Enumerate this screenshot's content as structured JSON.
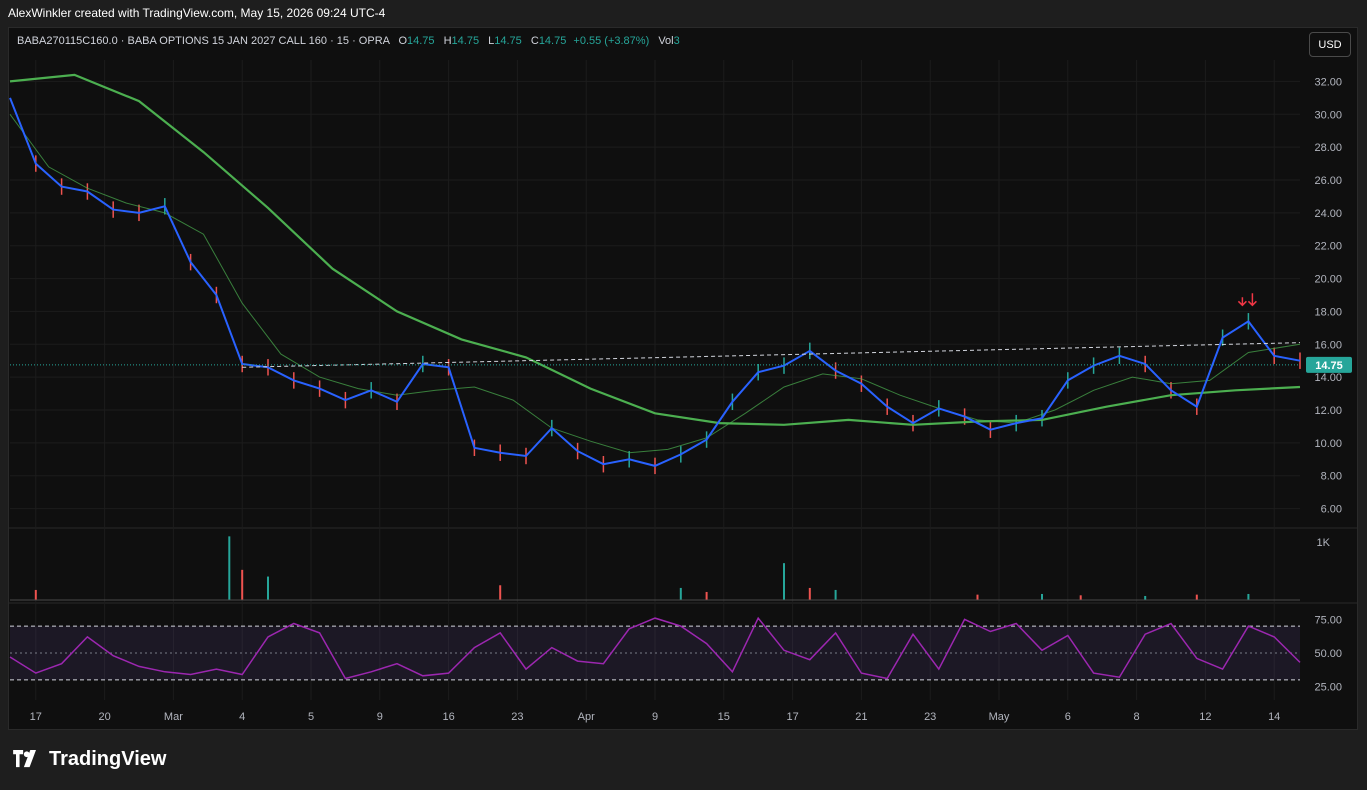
{
  "header": {
    "attribution": "AlexWinkler created with TradingView.com, May 15, 2026 09:24 UTC-4"
  },
  "legend": {
    "symbol": "BABA270115C160.0 · BABA OPTIONS 15 JAN 2027 CALL 160 · 15 · OPRA",
    "o_label": "O",
    "o_value": "14.75",
    "h_label": "H",
    "h_value": "14.75",
    "l_label": "L",
    "l_value": "14.75",
    "c_label": "C",
    "c_value": "14.75",
    "change": "+0.55 (+3.87%)",
    "vol_label": "Vol",
    "vol_value": "3"
  },
  "currency_button": "USD",
  "brand": {
    "name": "TradingView",
    "icon": "tradingview-logo"
  },
  "colors": {
    "price_line": "#2962ff",
    "ema_fast": "#4caf50",
    "ema_slow": "#4caf50",
    "candle_up": "#26a69a",
    "candle_down": "#ef5350",
    "rsi": "#9c27b0",
    "last_price_badge": "#26a69a",
    "signal_arrow": "#f23645"
  },
  "chart_data": [
    {
      "type": "line",
      "title": "",
      "ylim": [
        5,
        33
      ],
      "y_ticks": [
        "32.00",
        "30.00",
        "28.00",
        "26.00",
        "24.00",
        "22.00",
        "20.00",
        "18.00",
        "16.00",
        "14.00",
        "12.00",
        "10.00",
        "8.00",
        "6.00"
      ],
      "x_ticks": [
        "17",
        "20",
        "Mar",
        "4",
        "5",
        "9",
        "16",
        "23",
        "Apr",
        "9",
        "15",
        "17",
        "21",
        "23",
        "May",
        "6",
        "8",
        "12",
        "14"
      ],
      "last_price": "14.75",
      "series": [
        {
          "x": [
            0,
            2,
            4,
            6,
            8,
            10,
            12,
            14,
            16,
            18,
            20,
            22,
            24,
            26,
            28,
            30,
            32,
            34,
            36,
            38,
            40,
            42,
            44,
            46,
            48,
            50,
            52,
            54,
            56,
            58,
            60,
            62,
            64,
            66,
            68,
            70,
            72,
            74,
            76,
            78,
            80,
            82,
            84,
            86,
            88,
            90,
            92,
            94,
            96,
            98,
            100
          ],
          "values": [
            31,
            27,
            25.6,
            25.3,
            24.2,
            24,
            24.4,
            21,
            19,
            14.8,
            14.6,
            13.8,
            13.3,
            12.6,
            13.2,
            12.5,
            14.8,
            14.6,
            9.7,
            9.4,
            9.2,
            10.9,
            9.5,
            8.7,
            9.0,
            8.6,
            9.3,
            10.2,
            12.5,
            14.3,
            14.7,
            15.6,
            14.4,
            13.6,
            12.2,
            11.2,
            12.1,
            11.6,
            10.8,
            11.2,
            11.5,
            13.8,
            14.7,
            15.3,
            14.8,
            13.2,
            12.2,
            16.4,
            17.4,
            15.3,
            15.0
          ]
        },
        {
          "x": [
            0,
            3,
            6,
            9,
            12,
            15,
            18,
            21,
            24,
            27,
            30,
            33,
            36,
            39,
            42,
            45,
            48,
            51,
            54,
            57,
            60,
            63,
            66,
            69,
            72,
            75,
            78,
            81,
            84,
            87,
            90,
            93,
            96,
            100
          ],
          "values": [
            30,
            26.8,
            25.5,
            24.6,
            24,
            22.7,
            18.5,
            15.4,
            14,
            13.3,
            12.9,
            13.2,
            13.4,
            12.6,
            10.9,
            10.1,
            9.4,
            9.6,
            10.3,
            11.8,
            13.4,
            14.2,
            13.9,
            12.9,
            12.1,
            11.4,
            11.2,
            12.0,
            13.2,
            14.0,
            13.6,
            13.8,
            15.5,
            16.0
          ]
        },
        {
          "x": [
            0,
            5,
            10,
            15,
            20,
            25,
            30,
            35,
            40,
            45,
            50,
            55,
            60,
            65,
            70,
            75,
            80,
            85,
            90,
            95,
            100
          ],
          "values": [
            32,
            32.4,
            30.8,
            27.7,
            24.3,
            20.6,
            18.0,
            16.3,
            15.2,
            13.3,
            11.8,
            11.2,
            11.1,
            11.4,
            11.1,
            11.3,
            11.4,
            12.2,
            12.9,
            13.2,
            13.4
          ]
        }
      ]
    },
    {
      "type": "bar",
      "title": "",
      "y_ticks": [
        "1K"
      ],
      "x": [
        2,
        17,
        18,
        20,
        38,
        52,
        54,
        60,
        62,
        64,
        75,
        80,
        83,
        88,
        92,
        96
      ],
      "values": [
        150,
        950,
        450,
        350,
        220,
        180,
        120,
        550,
        180,
        150,
        80,
        90,
        70,
        60,
        80,
        90
      ]
    },
    {
      "type": "line",
      "title": "",
      "ylim": [
        15,
        85
      ],
      "y_ticks": [
        "75.00",
        "50.00",
        "25.00"
      ],
      "bands": [
        30,
        70
      ],
      "values": [
        47,
        35,
        42,
        62,
        48,
        40,
        36,
        34,
        38,
        34,
        62,
        72,
        65,
        31,
        36,
        42,
        33,
        35,
        54,
        65,
        38,
        54,
        44,
        42,
        68,
        76,
        70,
        57,
        36,
        76,
        52,
        45,
        65,
        35,
        31,
        64,
        38,
        75,
        66,
        72,
        52,
        63,
        35,
        32,
        64,
        72,
        46,
        38,
        70,
        62,
        43
      ]
    }
  ]
}
